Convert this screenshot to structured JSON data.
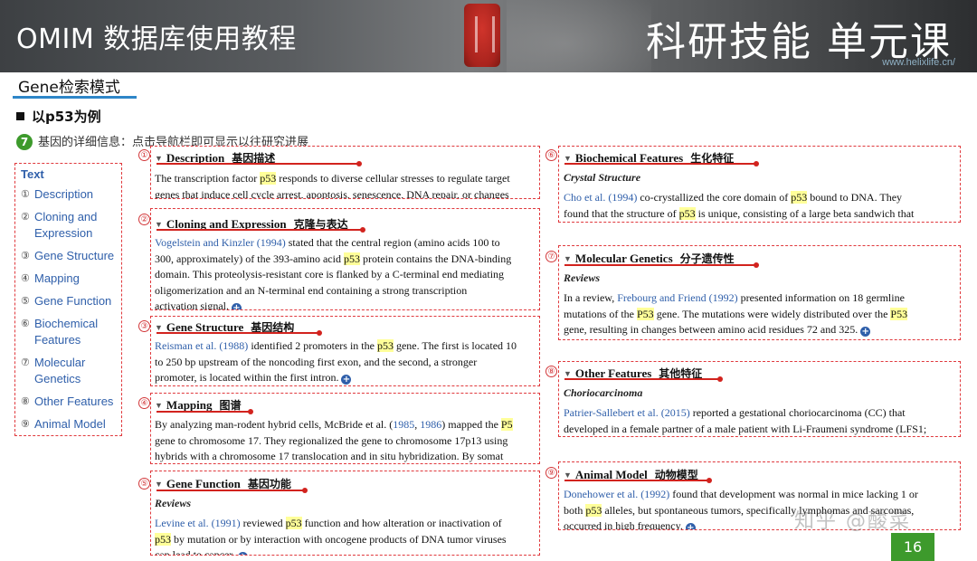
{
  "header": {
    "title": "OMIM 数据库使用教程",
    "course": "科研技能 单元课",
    "url": "www.helixlife.cn/"
  },
  "section_tag": "Gene检索模式",
  "heading": "以p53为例",
  "step": {
    "number": "7",
    "text": "基因的详细信息：点击导航栏即可显示以往研究进展"
  },
  "nav": {
    "head": "Text",
    "items": [
      {
        "n": "①",
        "label": "Description"
      },
      {
        "n": "②",
        "label": "Cloning and Expression"
      },
      {
        "n": "③",
        "label": "Gene Structure"
      },
      {
        "n": "④",
        "label": "Mapping"
      },
      {
        "n": "⑤",
        "label": "Gene Function"
      },
      {
        "n": "⑥",
        "label": "Biochemical Features"
      },
      {
        "n": "⑦",
        "label": "Molecular Genetics"
      },
      {
        "n": "⑧",
        "label": "Other Features"
      },
      {
        "n": "⑨",
        "label": "Animal Model"
      }
    ]
  },
  "panels": {
    "p1": {
      "num": "①",
      "title": "Description",
      "cn": "基因描述",
      "l1a": "The transcription factor ",
      "l1h": "p53",
      "l1b": " responds to diverse cellular stresses to regulate target",
      "l2": "genes that induce cell cycle arrest, apoptosis, senescence, DNA repair, or changes"
    },
    "p2": {
      "num": "②",
      "title": "Cloning and Expression",
      "cn": "克隆与表达",
      "link": "Vogelstein and Kinzler (1994)",
      "l1b": " stated that the central region (amino acids 100 to",
      "l2a": "300, approximately) of the 393-amino acid ",
      "l2h": "p53",
      "l2b": " protein contains the DNA-binding",
      "l3": "domain. This proteolysis-resistant core is flanked by a C-terminal end mediating",
      "l4": "oligomerization and an N-terminal end containing a strong transcription",
      "l5": "activation signal."
    },
    "p3": {
      "num": "③",
      "title": "Gene Structure",
      "cn": "基因结构",
      "link": "Reisman et al. (1988)",
      "l1a": " identified 2 promoters in the ",
      "l1h": "p53",
      "l1b": " gene. The first is located 10",
      "l2": "to 250 bp upstream of the noncoding first exon, and the second, a stronger",
      "l3": "promoter, is located within the first intron."
    },
    "p4": {
      "num": "④",
      "title": "Mapping",
      "cn": "图谱",
      "l1a": "By analyzing man-rodent hybrid cells, McBride et al. (",
      "link1": "1985",
      "l1m": ", ",
      "link2": "1986",
      "l1b": ") mapped the ",
      "l1h": "P5",
      "l2": "gene to chromosome 17. They regionalized the gene to chromosome 17p13 using",
      "l3": "hybrids with a chromosome 17 translocation and in situ hybridization. By somat"
    },
    "p5": {
      "num": "⑤",
      "title": "Gene Function",
      "cn": "基因功能",
      "sub": "Reviews",
      "link": "Levine et al. (1991)",
      "l1a": " reviewed ",
      "l1h": "p53",
      "l1b": " function and how alteration or inactivation of",
      "l2h": "p53",
      "l2b": " by mutation or by interaction with oncogene products of DNA tumor viruses",
      "l3": "can lead to cancer."
    },
    "p6": {
      "num": "⑥",
      "title": "Biochemical Features",
      "cn": "生化特征",
      "sub": "Crystal Structure",
      "link": "Cho et al. (1994)",
      "l1a": " co-crystallized the core domain of ",
      "l1h": "p53",
      "l1b": " bound to DNA. They",
      "l2a": "found that the structure of ",
      "l2h": "p53",
      "l2b": " is unique, consisting of a large beta sandwich that"
    },
    "p7": {
      "num": "⑦",
      "title": "Molecular Genetics",
      "cn": "分子遗传性",
      "sub": "Reviews",
      "l1a": "In a review, ",
      "link": "Frebourg and Friend (1992)",
      "l1b": " presented information on 18 germline",
      "l2a": "mutations of the ",
      "l2h": "P53",
      "l2b": " gene. The mutations were widely distributed over the ",
      "l2h2": "P53",
      "l3": "gene, resulting in changes between amino acid residues 72 and 325."
    },
    "p8": {
      "num": "⑧",
      "title": "Other Features",
      "cn": "其他特征",
      "sub": "Choriocarcinoma",
      "link": "Patrier-Sallebert et al. (2015)",
      "l1b": " reported a gestational choriocarcinoma (CC) that",
      "l2": "developed in a female partner of a male patient with Li-Fraumeni syndrome (LFS1;"
    },
    "p9": {
      "num": "⑨",
      "title": "Animal Model",
      "cn": "动物模型",
      "link": "Donehower et al. (1992)",
      "l1b": " found that development was normal in mice lacking 1 or",
      "l2a": "both ",
      "l2h": "p53",
      "l2b": " alleles, but spontaneous tumors, specifically lymphomas and sarcomas,",
      "l3": "occurred in high frequency."
    }
  },
  "expand_icon": "+",
  "watermark": "知乎 @酸菜",
  "page_number": "16"
}
